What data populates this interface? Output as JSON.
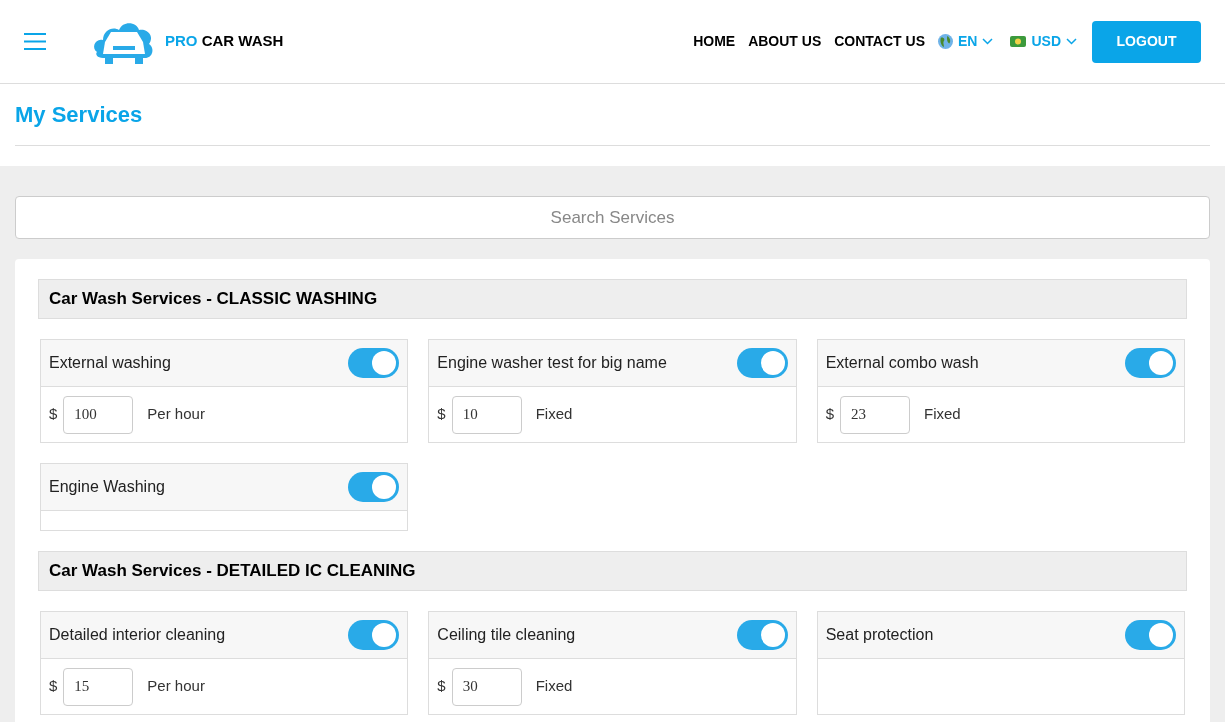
{
  "header": {
    "brand_accent": "PRO",
    "brand": "CAR WASH",
    "nav": [
      "HOME",
      "ABOUT US",
      "CONTACT US"
    ],
    "language": "EN",
    "currency": "USD",
    "logout": "LOGOUT"
  },
  "page_title": "My Services",
  "search": {
    "placeholder": "Search Services"
  },
  "groups": [
    {
      "title": "Car Wash Services - CLASSIC WASHING",
      "services": [
        {
          "name": "External washing",
          "on": true,
          "currency": "$",
          "price": "100",
          "unit": "Per hour"
        },
        {
          "name": "Engine washer test for big name",
          "on": true,
          "currency": "$",
          "price": "10",
          "unit": "Fixed"
        },
        {
          "name": "External combo wash",
          "on": true,
          "currency": "$",
          "price": "23",
          "unit": "Fixed"
        },
        {
          "name": "Engine Washing",
          "on": true
        }
      ]
    },
    {
      "title": "Car Wash Services - DETAILED IC CLEANING",
      "services": [
        {
          "name": "Detailed interior cleaning",
          "on": true,
          "currency": "$",
          "price": "15",
          "unit": "Per hour"
        },
        {
          "name": "Ceiling tile cleaning",
          "on": true,
          "currency": "$",
          "price": "30",
          "unit": "Fixed"
        },
        {
          "name": "Seat protection",
          "on": true
        }
      ]
    }
  ]
}
